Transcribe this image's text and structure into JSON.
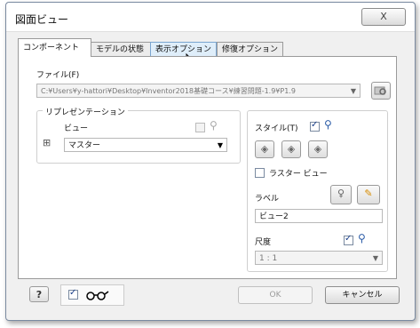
{
  "window": {
    "title": "図面ビュー",
    "close_glyph": "X"
  },
  "tabs": [
    {
      "label": "コンポーネント"
    },
    {
      "label": "モデルの状態"
    },
    {
      "label": "表示オプション"
    },
    {
      "label": "修復オプション"
    }
  ],
  "file": {
    "label": "ファイル(F)",
    "path": "C:¥Users¥y-hattori¥Desktop¥Inventor2018基礎コース¥練習問題-1.9¥P1.9"
  },
  "representation": {
    "group_title": "リプレゼンテーション",
    "view_label": "ビュー",
    "view_value": "マスター"
  },
  "style": {
    "label": "スタイル(T)"
  },
  "raster_view": {
    "label": "ラスター ビュー"
  },
  "label_section": {
    "label": "ラベル",
    "value": "ビュー2"
  },
  "scale": {
    "label": "尺度",
    "value": "1 : 1"
  },
  "footer": {
    "ok_label": "OK",
    "cancel_label": "キャンセル"
  }
}
